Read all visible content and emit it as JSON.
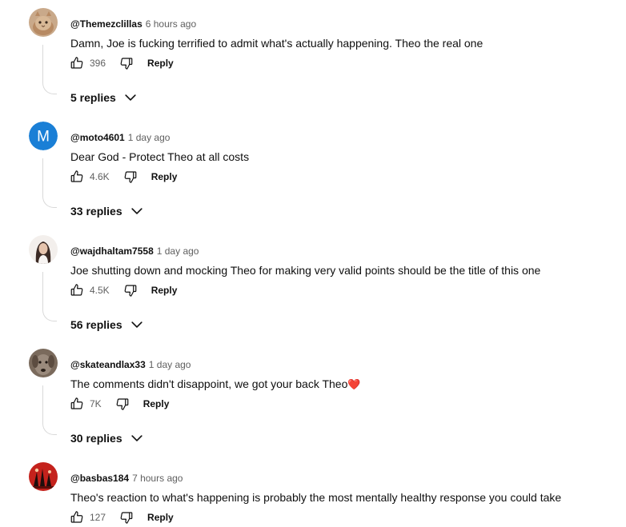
{
  "comments": [
    {
      "handle": "@Themezclillas",
      "time": "6 hours ago",
      "text": "Damn, Joe is fucking terrified to admit what's actually happening. Theo the real one",
      "likes": "396",
      "reply_label": "Reply",
      "replies_label": "5 replies",
      "avatar": "cat-photo-avatar"
    },
    {
      "handle": "@moto4601",
      "time": "1 day ago",
      "text": "Dear God - Protect Theo at all costs",
      "likes": "4.6K",
      "reply_label": "Reply",
      "replies_label": "33 replies",
      "avatar_letter": "M",
      "avatar_color": "#1a7fd6"
    },
    {
      "handle": "@wajdhaltam7558",
      "time": "1 day ago",
      "text": "Joe shutting down and mocking Theo for making very valid points should be the title of this one",
      "likes": "4.5K",
      "reply_label": "Reply",
      "replies_label": "56 replies",
      "avatar": "woman-photo-avatar"
    },
    {
      "handle": "@skateandlax33",
      "time": "1 day ago",
      "text": "The comments didn't disappoint,  we got your back Theo",
      "text_emoji": "❤️",
      "likes": "7K",
      "reply_label": "Reply",
      "replies_label": "30 replies",
      "avatar": "dog-photo-avatar"
    },
    {
      "handle": "@basbas184",
      "time": "7 hours ago",
      "text": "Theo's reaction to what's happening is probably the most mentally healthy response you could take",
      "likes": "127",
      "reply_label": "Reply",
      "avatar": "red-art-avatar"
    }
  ]
}
